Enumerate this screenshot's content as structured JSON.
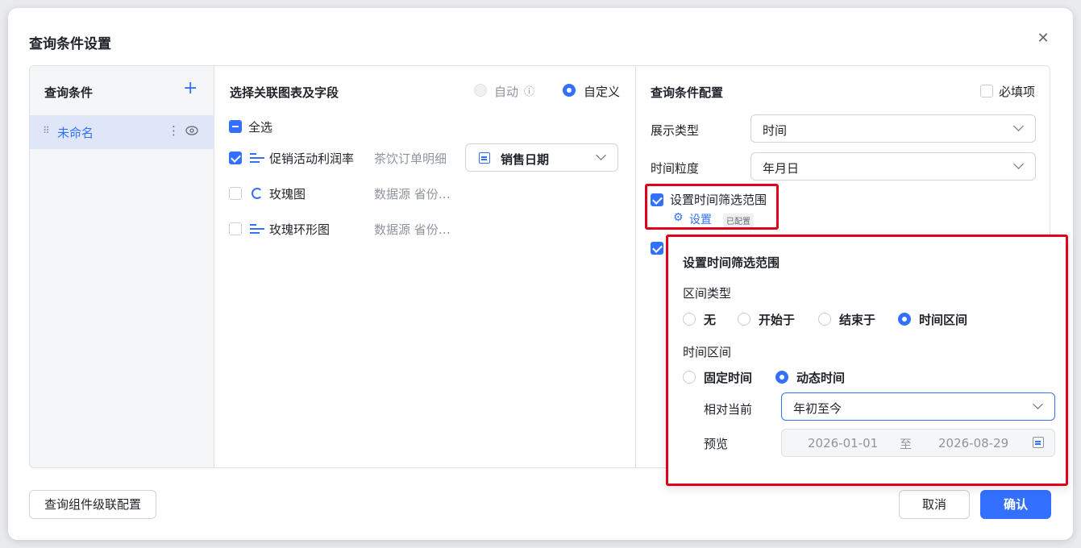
{
  "dialog": {
    "title": "查询条件设置",
    "close_icon": "close-icon"
  },
  "conditions": {
    "header": "查询条件",
    "add_icon": "plus-icon",
    "items": [
      {
        "label": "未命名"
      }
    ]
  },
  "charts": {
    "header": "选择关联图表及字段",
    "mode_auto": "自动",
    "mode_custom": "自定义",
    "select_all": "全选",
    "rows": [
      {
        "name": "促销活动利润率",
        "source": "茶饮订单明细",
        "checked": true,
        "field": "销售日期"
      },
      {
        "name": "玫瑰图",
        "source": "数据源 省份…",
        "checked": false
      },
      {
        "name": "玫瑰环形图",
        "source": "数据源 省份…",
        "checked": false
      }
    ]
  },
  "config": {
    "header": "查询条件配置",
    "required_label": "必填项",
    "display_type_label": "展示类型",
    "display_type_value": "时间",
    "granularity_label": "时间粒度",
    "granularity_value": "年月日",
    "time_range_label": "设置时间筛选范围",
    "settings_link": "设置",
    "configured_badge": "已配置"
  },
  "popup": {
    "title": "设置时间筛选范围",
    "range_type_label": "区间类型",
    "range_options": [
      "无",
      "开始于",
      "结束于",
      "时间区间"
    ],
    "range_selected": "时间区间",
    "interval_label": "时间区间",
    "interval_options": [
      "固定时间",
      "动态时间"
    ],
    "interval_selected": "动态时间",
    "relative_label": "相对当前",
    "relative_value": "年初至今",
    "preview_label": "预览",
    "preview_start": "2026-01-01",
    "preview_sep": "至",
    "preview_end": "2026-08-29"
  },
  "footer": {
    "cascade_button": "查询组件级联配置",
    "cancel_button": "取消",
    "confirm_button": "确认"
  },
  "colors": {
    "accent": "#3370ff",
    "highlight": "#e0001b"
  }
}
